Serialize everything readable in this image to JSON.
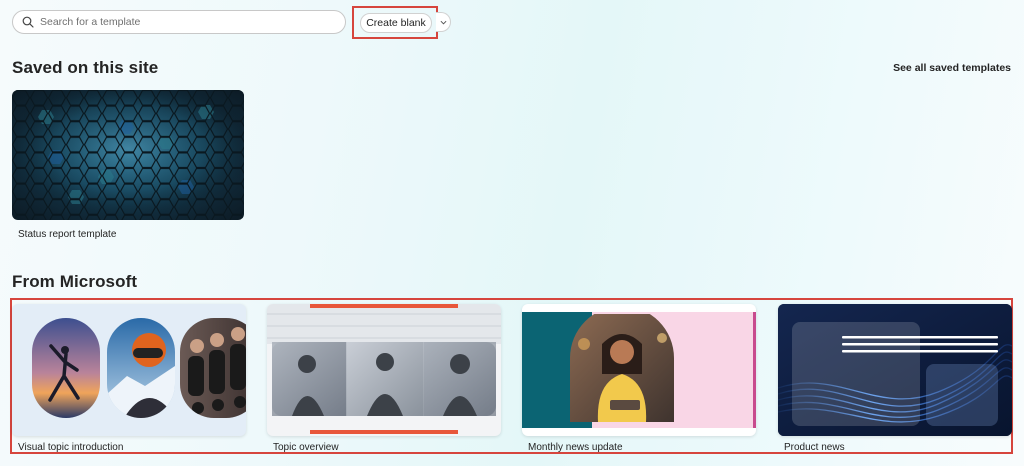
{
  "search": {
    "placeholder": "Search for a template",
    "icon": "search-icon"
  },
  "toolbar": {
    "create_blank_label": "Create blank",
    "dropdown_icon": "chevron-down-icon"
  },
  "saved": {
    "heading": "Saved on this site",
    "see_all_label": "See all saved templates",
    "templates": [
      {
        "label": "Status report template"
      }
    ]
  },
  "microsoft": {
    "heading": "From Microsoft",
    "templates": [
      {
        "label": "Visual topic introduction"
      },
      {
        "label": "Topic overview"
      },
      {
        "label": "Monthly news update"
      },
      {
        "label": "Product news"
      }
    ]
  },
  "colors": {
    "highlight": "#d6453d",
    "accent_orange": "#e8563a",
    "teal": "#0b6473",
    "pink": "#f7d3e3",
    "navy": "#0d1f44"
  }
}
